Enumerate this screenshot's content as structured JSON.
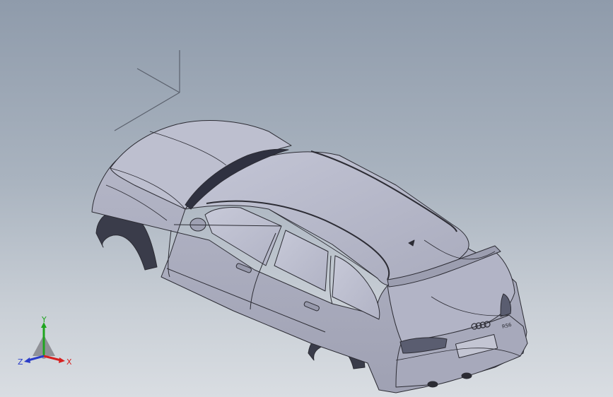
{
  "app": {
    "title": ""
  },
  "viewport": {
    "background_top": "#8f9bab",
    "background_bottom": "#d9dde2"
  },
  "model": {
    "body_color": "#b7b9c9",
    "edge_color": "#2c2c34",
    "badge_text": "RS6"
  },
  "triad": {
    "x_label": "X",
    "y_label": "Y",
    "z_label": "Z",
    "x_color": "#d62020",
    "y_color": "#1fa51f",
    "z_color": "#2a3cc8"
  }
}
